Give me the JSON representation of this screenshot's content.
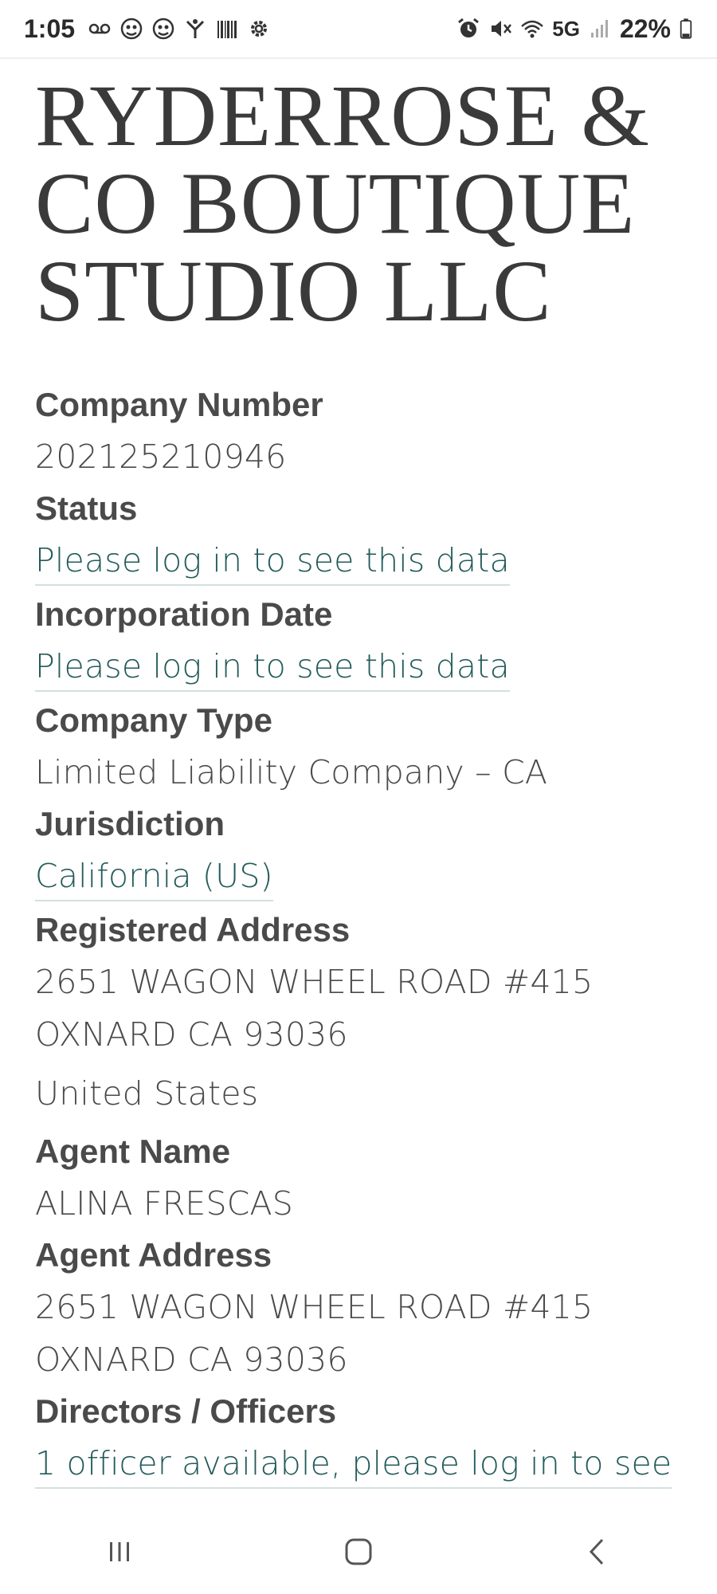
{
  "status_bar": {
    "time": "1:05",
    "network": "5G",
    "battery": "22%",
    "left_icons": [
      "voicemail-icon",
      "app-icon-1",
      "app-icon-2",
      "fitness-icon",
      "barcode-icon",
      "settings-icon"
    ],
    "right_icons": [
      "alarm-icon",
      "mute-icon",
      "wifi-icon",
      "signal-icon",
      "battery-icon"
    ]
  },
  "company": {
    "name": "RYDERROSE & CO BOUTIQUE STUDIO LLC"
  },
  "fields": {
    "company_number_label": "Company Number",
    "company_number_value": "202125210946",
    "status_label": "Status",
    "status_value": "Please log in to see this data",
    "incorporation_date_label": "Incorporation Date",
    "incorporation_date_value": "Please log in to see this data",
    "company_type_label": "Company Type",
    "company_type_value": "Limited Liability Company – CA",
    "jurisdiction_label": "Jurisdiction",
    "jurisdiction_value": "California (US)",
    "registered_address_label": "Registered Address",
    "registered_address_line1": "2651 WAGON WHEEL ROAD #415",
    "registered_address_line2": "OXNARD CA 93036",
    "registered_address_country": "United States",
    "agent_name_label": "Agent Name",
    "agent_name_value": "ALINA FRESCAS",
    "agent_address_label": "Agent Address",
    "agent_address_line1": "2651 WAGON WHEEL ROAD #415",
    "agent_address_line2": "OXNARD CA 93036",
    "directors_label": "Directors / Officers",
    "directors_value": "1 officer available, please log in to see"
  },
  "nav_bar": {
    "icons": [
      "recent-apps-icon",
      "home-icon",
      "back-icon"
    ]
  },
  "colors": {
    "link": "#235b5a",
    "text": "#4a4a4a",
    "title": "#3a3a3a"
  }
}
